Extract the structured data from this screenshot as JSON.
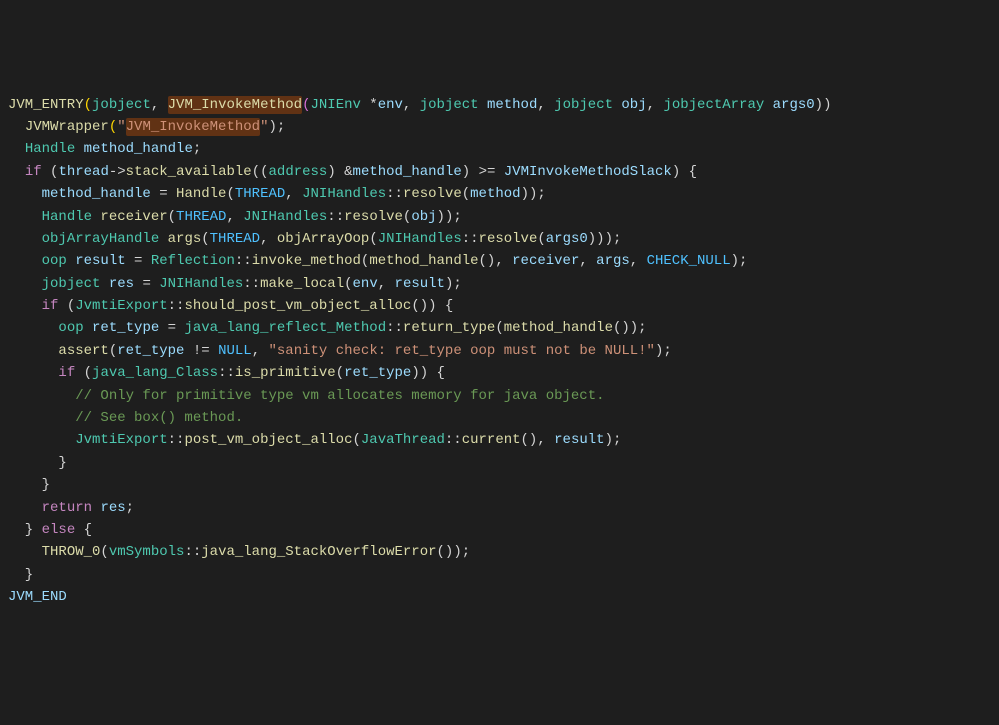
{
  "code": {
    "l1": {
      "t1": "JVM_ENTRY",
      "t2": "(",
      "t3": "jobject",
      "t4": ", ",
      "t5": "JVM_InvokeMethod",
      "t6": "(",
      "t7": "JNIEnv ",
      "t8": "*",
      "t9": "env",
      "t10": ", ",
      "t11": "jobject ",
      "t12": "method",
      "t13": ", ",
      "t14": "jobject ",
      "t15": "obj",
      "t16": ", ",
      "t17": "jobjectArray ",
      "t18": "args0",
      "t19": "))"
    },
    "l2": {
      "t1": "  ",
      "t2": "JVMWrapper",
      "t3": "(",
      "t4": "\"",
      "t5": "JVM_InvokeMethod",
      "t6": "\"",
      "t7": ");"
    },
    "l3": {
      "t1": "  ",
      "t2": "Handle ",
      "t3": "method_handle",
      "t4": ";"
    },
    "l4": {
      "t1": "  ",
      "t2": "if",
      "t3": " (",
      "t4": "thread",
      "t5": "->",
      "t6": "stack_available",
      "t7": "((",
      "t8": "address",
      "t9": ") &",
      "t10": "method_handle",
      "t11": ") >= ",
      "t12": "JVMInvokeMethodSlack",
      "t13": ") {"
    },
    "l5": {
      "t1": "    ",
      "t2": "method_handle",
      "t3": " = ",
      "t4": "Handle",
      "t5": "(",
      "t6": "THREAD",
      "t7": ", ",
      "t8": "JNIHandles",
      "t9": "::",
      "t10": "resolve",
      "t11": "(",
      "t12": "method",
      "t13": "));"
    },
    "l6": {
      "t1": "    ",
      "t2": "Handle ",
      "t3": "receiver",
      "t4": "(",
      "t5": "THREAD",
      "t6": ", ",
      "t7": "JNIHandles",
      "t8": "::",
      "t9": "resolve",
      "t10": "(",
      "t11": "obj",
      "t12": "));"
    },
    "l7": {
      "t1": "    ",
      "t2": "objArrayHandle ",
      "t3": "args",
      "t4": "(",
      "t5": "THREAD",
      "t6": ", ",
      "t7": "objArrayOop",
      "t8": "(",
      "t9": "JNIHandles",
      "t10": "::",
      "t11": "resolve",
      "t12": "(",
      "t13": "args0",
      "t14": ")));"
    },
    "l8": {
      "t1": "    ",
      "t2": "oop ",
      "t3": "result",
      "t4": " = ",
      "t5": "Reflection",
      "t6": "::",
      "t7": "invoke_method",
      "t8": "(",
      "t9": "method_handle",
      "t10": "(), ",
      "t11": "receiver",
      "t12": ", ",
      "t13": "args",
      "t14": ", ",
      "t15": "CHECK_NULL",
      "t16": ");"
    },
    "l9": {
      "t1": "    ",
      "t2": "jobject ",
      "t3": "res",
      "t4": " = ",
      "t5": "JNIHandles",
      "t6": "::",
      "t7": "make_local",
      "t8": "(",
      "t9": "env",
      "t10": ", ",
      "t11": "result",
      "t12": ");"
    },
    "l10": {
      "t1": "    ",
      "t2": "if",
      "t3": " (",
      "t4": "JvmtiExport",
      "t5": "::",
      "t6": "should_post_vm_object_alloc",
      "t7": "()) {"
    },
    "l11": {
      "t1": "      ",
      "t2": "oop ",
      "t3": "ret_type",
      "t4": " = ",
      "t5": "java_lang_reflect_Method",
      "t6": "::",
      "t7": "return_type",
      "t8": "(",
      "t9": "method_handle",
      "t10": "());"
    },
    "l12": {
      "t1": "      ",
      "t2": "assert",
      "t3": "(",
      "t4": "ret_type",
      "t5": " != ",
      "t6": "NULL",
      "t7": ", ",
      "t8": "\"sanity check: ret_type oop must not be NULL!\"",
      "t9": ");"
    },
    "l13": {
      "t1": "      ",
      "t2": "if",
      "t3": " (",
      "t4": "java_lang_Class",
      "t5": "::",
      "t6": "is_primitive",
      "t7": "(",
      "t8": "ret_type",
      "t9": ")) {"
    },
    "l14": {
      "t1": "        ",
      "t2": "// Only for primitive type vm allocates memory for java object."
    },
    "l15": {
      "t1": "        ",
      "t2": "// See box() method."
    },
    "l16": {
      "t1": "        ",
      "t2": "JvmtiExport",
      "t3": "::",
      "t4": "post_vm_object_alloc",
      "t5": "(",
      "t6": "JavaThread",
      "t7": "::",
      "t8": "current",
      "t9": "(), ",
      "t10": "result",
      "t11": ");"
    },
    "l17": {
      "t1": "      }"
    },
    "l18": {
      "t1": "    }"
    },
    "l19": {
      "t1": "    ",
      "t2": "return",
      "t3": " ",
      "t4": "res",
      "t5": ";"
    },
    "l20": {
      "t1": "  } ",
      "t2": "else",
      "t3": " {"
    },
    "l21": {
      "t1": "    ",
      "t2": "THROW_0",
      "t3": "(",
      "t4": "vmSymbols",
      "t5": "::",
      "t6": "java_lang_StackOverflowError",
      "t7": "());"
    },
    "l22": {
      "t1": "  }"
    },
    "l23": {
      "t1": "JVM_END"
    }
  }
}
